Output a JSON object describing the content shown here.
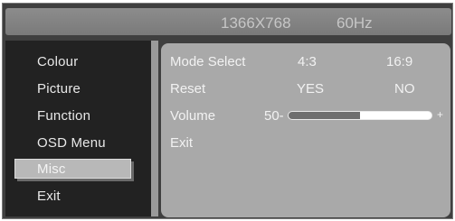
{
  "header": {
    "resolution": "1366X768",
    "refresh_rate": "60Hz"
  },
  "menu": {
    "items": [
      {
        "label": "Colour",
        "selected": false
      },
      {
        "label": "Picture",
        "selected": false
      },
      {
        "label": "Function",
        "selected": false
      },
      {
        "label": "OSD Menu",
        "selected": false
      },
      {
        "label": "Misc",
        "selected": true
      },
      {
        "label": "Exit",
        "selected": false
      }
    ]
  },
  "misc": {
    "mode_select": {
      "label": "Mode Select",
      "options": [
        "4:3",
        "16:9"
      ]
    },
    "reset": {
      "label": "Reset",
      "options": [
        "YES",
        "NO"
      ]
    },
    "volume": {
      "label": "Volume",
      "value_label": "50-",
      "level": 0.5,
      "plus": "+"
    },
    "exit": {
      "label": "Exit"
    }
  },
  "colors": {
    "osd_background": "#3f3f3f",
    "menu_panel": "#222222",
    "content_panel": "#a9a9a9",
    "selection": "#b8b8b8",
    "text": "#f2f2f2"
  }
}
